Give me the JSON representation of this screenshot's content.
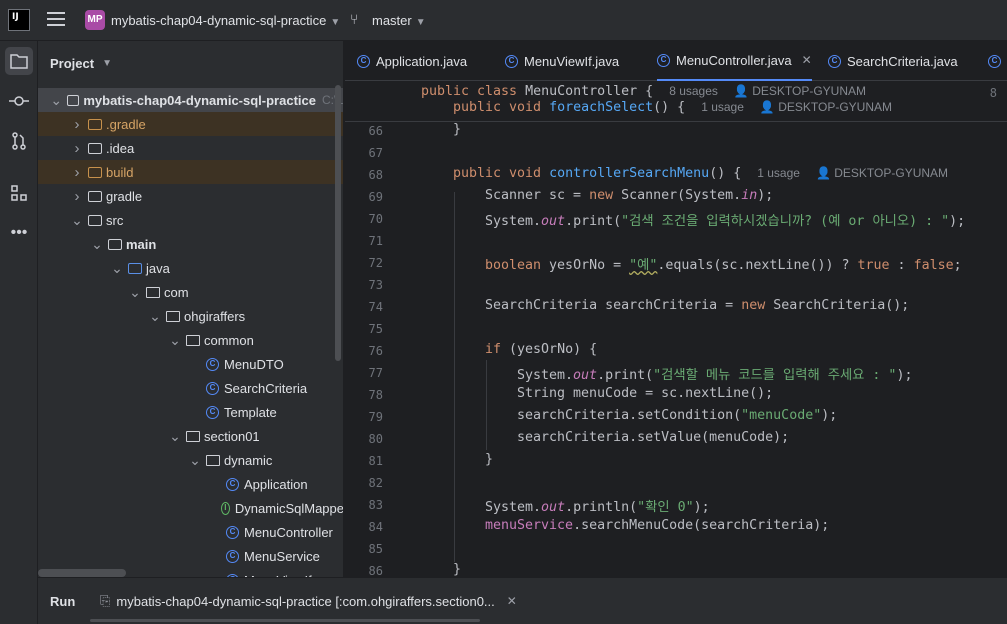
{
  "topbar": {
    "logo": "IJ",
    "project_badge": "MP",
    "project_name": "mybatis-chap04-dynamic-sql-practice",
    "branch": "master"
  },
  "project_panel": {
    "title": "Project",
    "tree": [
      {
        "label": "mybatis-chap04-dynamic-sql-practice",
        "extra": "C:\\L",
        "icon": "module-folder-icon",
        "arrow": "open",
        "bold": true
      },
      {
        "label": ".gradle",
        "icon": "folder-icon",
        "arrow": "closed",
        "tone": "excluded"
      },
      {
        "label": ".idea",
        "icon": "folder-icon",
        "arrow": "closed"
      },
      {
        "label": "build",
        "icon": "folder-icon",
        "arrow": "closed",
        "tone": "excluded"
      },
      {
        "label": "gradle",
        "icon": "folder-icon",
        "arrow": "closed"
      },
      {
        "label": "src",
        "icon": "folder-icon",
        "arrow": "open"
      },
      {
        "label": "main",
        "icon": "folder-icon",
        "arrow": "open",
        "bold": true
      },
      {
        "label": "java",
        "icon": "source-folder-icon",
        "arrow": "open"
      },
      {
        "label": "com",
        "icon": "package-icon",
        "arrow": "open"
      },
      {
        "label": "ohgiraffers",
        "icon": "package-icon",
        "arrow": "open"
      },
      {
        "label": "common",
        "icon": "package-icon",
        "arrow": "open"
      },
      {
        "label": "MenuDTO",
        "icon": "class-icon"
      },
      {
        "label": "SearchCriteria",
        "icon": "class-icon"
      },
      {
        "label": "Template",
        "icon": "class-icon"
      },
      {
        "label": "section01",
        "icon": "package-icon",
        "arrow": "open"
      },
      {
        "label": "dynamic",
        "icon": "package-icon",
        "arrow": "open"
      },
      {
        "label": "Application",
        "icon": "class-icon"
      },
      {
        "label": "DynamicSqlMappe",
        "icon": "interface-icon"
      },
      {
        "label": "MenuController",
        "icon": "class-icon"
      },
      {
        "label": "MenuService",
        "icon": "class-icon"
      },
      {
        "label": "MenuViewIf",
        "icon": "class-icon"
      }
    ]
  },
  "tabs": [
    {
      "label": "Application.java"
    },
    {
      "label": "MenuViewIf.java"
    },
    {
      "label": "MenuController.java",
      "active": true
    },
    {
      "label": "SearchCriteria.java"
    }
  ],
  "editor": {
    "sticky": {
      "line1_no": "8",
      "line1_code": "public class MenuController {",
      "line1_usages": "8 usages",
      "line1_author": "DESKTOP-GYUNAM",
      "line2_code": "public void foreachSelect() {",
      "line2_usages": "1 usage",
      "line2_author": "DESKTOP-GYUNAM"
    },
    "line_numbers": [
      "66",
      "67",
      "68",
      "69",
      "70",
      "71",
      "72",
      "73",
      "74",
      "75",
      "76",
      "77",
      "78",
      "79",
      "80",
      "81",
      "82",
      "83",
      "84",
      "85",
      "86"
    ],
    "method_hint_usages": "1 usage",
    "method_hint_author": "DESKTOP-GYUNAM",
    "str_prompt1": "\"검색 조건을 입력하시겠습니까? (예 or 아니오) : \"",
    "str_yes": "\"예\"",
    "str_prompt2": "\"검색할 메뉴 코드를 입력해 주세요 : \"",
    "str_menucode": "\"menuCode\"",
    "str_check": "\"확인 0\""
  },
  "bottom": {
    "run_label": "Run",
    "run_tab": "mybatis-chap04-dynamic-sql-practice [:com.ohgiraffers.section0..."
  }
}
